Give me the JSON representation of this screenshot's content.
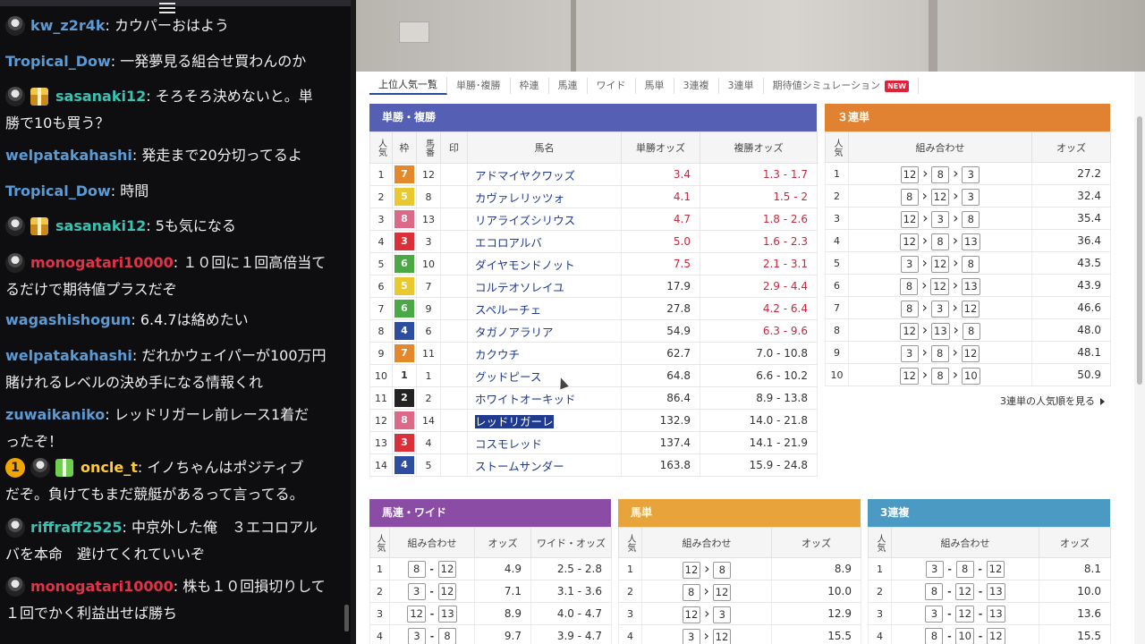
{
  "chat": {
    "messages": [
      {
        "user": "kw_z2r4k",
        "text": ": カウパーおはよう",
        "color": "#5b9bd5",
        "badges": [
          "avatar"
        ]
      },
      {
        "user": "Tropical_Dow",
        "text": ": 一発夢見る組合せ買わんのか",
        "color": "#5b9bd5",
        "badges": []
      },
      {
        "user": "sasanaki12",
        "text": ": そろそろ決めないと。単",
        "cont": "勝で10も買う？",
        "color": "#38c3b3",
        "badges": [
          "avatar",
          "gift"
        ]
      },
      {
        "user": "welpatakahashi",
        "text": ": 発走まで20分切ってるよ",
        "color": "#5b9bd5",
        "badges": []
      },
      {
        "user": "Tropical_Dow",
        "text": ": 時間",
        "color": "#5b9bd5",
        "badges": []
      },
      {
        "user": "sasanaki12",
        "text": ": 5も気になる",
        "color": "#38c3b3",
        "badges": [
          "avatar",
          "gift"
        ]
      },
      {
        "user": "monogatari10000",
        "text": ": １０回に１回高倍当て",
        "cont": "るだけで期待値プラスだぞ",
        "color": "#e0334a",
        "badges": [
          "avatar"
        ]
      },
      {
        "user": "wagashishogun",
        "text": ": 6.4.7は絡めたい",
        "color": "#5b9bd5",
        "badges": []
      },
      {
        "user": "welpatakahashi",
        "text": ": だれかウェイパーが100万円",
        "cont": "賭けれるレベルの決め手になる情報くれ",
        "color": "#5b9bd5",
        "badges": []
      },
      {
        "user": "zuwaikaniko",
        "text": ": レッドリガーレ前レース1着だ",
        "cont": "ったぞ！",
        "color": "#5b9bd5",
        "badges": []
      },
      {
        "user": "oncle_t",
        "text": ": イノちゃんはポジティブ",
        "cont": "だぞ。負けてもまだ競艇があるって言ってる。",
        "color": "#ffcc33",
        "badges": [
          "num",
          "avatar",
          "gift2"
        ],
        "num": "1"
      },
      {
        "user": "riffraff2525",
        "text": ": 中京外した俺　３エコロアル",
        "cont": "バを本命　避けてくれていいぞ",
        "color": "#38c3b3",
        "badges": [
          "avatar"
        ]
      },
      {
        "user": "monogatari10000",
        "text": ": 株も１０回損切りして",
        "cont": "１回でかく利益出せば勝ち",
        "color": "#e0334a",
        "badges": [
          "avatar"
        ]
      }
    ]
  },
  "tabs": [
    {
      "label": "上位人気一覧",
      "active": true
    },
    {
      "label": "単勝･複勝"
    },
    {
      "label": "枠連"
    },
    {
      "label": "馬連"
    },
    {
      "label": "ワイド"
    },
    {
      "label": "馬単"
    },
    {
      "label": "3連複"
    },
    {
      "label": "3連単"
    },
    {
      "label": "期待値シミュレーション",
      "new": "NEW"
    }
  ],
  "win_place": {
    "title": "単勝・複勝",
    "headers": [
      "人気",
      "枠",
      "馬番",
      "印",
      "馬名",
      "単勝オッズ",
      "複勝オッズ"
    ],
    "rows": [
      {
        "pop": "1",
        "waku": "7",
        "num": "12",
        "name": "アドマイヤクワッズ",
        "win": "3.4",
        "place": "1.3 - 1.7",
        "win_red": true,
        "place_red": true
      },
      {
        "pop": "2",
        "waku": "5",
        "num": "8",
        "name": "カヴァレリッツォ",
        "win": "4.1",
        "place": "1.5 - 2",
        "win_red": true,
        "place_red": true
      },
      {
        "pop": "3",
        "waku": "8",
        "num": "13",
        "name": "リアライズシリウス",
        "win": "4.7",
        "place": "1.8 - 2.6",
        "win_red": true,
        "place_red": true
      },
      {
        "pop": "4",
        "waku": "3",
        "num": "3",
        "name": "エコロアルバ",
        "win": "5.0",
        "place": "1.6 - 2.3",
        "win_red": true,
        "place_red": true
      },
      {
        "pop": "5",
        "waku": "6",
        "num": "10",
        "name": "ダイヤモンドノット",
        "win": "7.5",
        "place": "2.1 - 3.1",
        "win_red": true,
        "place_red": true
      },
      {
        "pop": "6",
        "waku": "5",
        "num": "7",
        "name": "コルテオソレイユ",
        "win": "17.9",
        "place": "2.9 - 4.4",
        "win_red": false,
        "place_red": true
      },
      {
        "pop": "7",
        "waku": "6",
        "num": "9",
        "name": "スペルーチェ",
        "win": "27.8",
        "place": "4.2 - 6.4",
        "win_red": false,
        "place_red": true
      },
      {
        "pop": "8",
        "waku": "4",
        "num": "6",
        "name": "タガノアラリア",
        "win": "54.9",
        "place": "6.3 - 9.6",
        "win_red": false,
        "place_red": true
      },
      {
        "pop": "9",
        "waku": "7",
        "num": "11",
        "name": "カクウチ",
        "win": "62.7",
        "place": "7.0 - 10.8",
        "win_red": false,
        "place_red": false
      },
      {
        "pop": "10",
        "waku": "1",
        "num": "1",
        "name": "グッドピース",
        "win": "64.8",
        "place": "6.6 - 10.2",
        "win_red": false,
        "place_red": false
      },
      {
        "pop": "11",
        "waku": "2",
        "num": "2",
        "name": "ホワイトオーキッド",
        "win": "86.4",
        "place": "8.9 - 13.8",
        "win_red": false,
        "place_red": false
      },
      {
        "pop": "12",
        "waku": "8",
        "num": "14",
        "name": "レッドリガーレ",
        "win": "132.9",
        "place": "14.0 - 21.8",
        "win_red": false,
        "place_red": false,
        "selected": true
      },
      {
        "pop": "13",
        "waku": "3",
        "num": "4",
        "name": "コスモレッド",
        "win": "137.4",
        "place": "14.1 - 21.9",
        "win_red": false,
        "place_red": false
      },
      {
        "pop": "14",
        "waku": "4",
        "num": "5",
        "name": "ストームサンダー",
        "win": "163.8",
        "place": "15.9 - 24.8",
        "win_red": false,
        "place_red": false
      }
    ]
  },
  "trifecta": {
    "title": "３連単",
    "headers": [
      "人気",
      "組み合わせ",
      "オッズ"
    ],
    "rows": [
      {
        "pop": "1",
        "combo": [
          "12",
          "8",
          "3"
        ],
        "odds": "27.2"
      },
      {
        "pop": "2",
        "combo": [
          "8",
          "12",
          "3"
        ],
        "odds": "32.4"
      },
      {
        "pop": "3",
        "combo": [
          "12",
          "3",
          "8"
        ],
        "odds": "35.4"
      },
      {
        "pop": "4",
        "combo": [
          "12",
          "8",
          "13"
        ],
        "odds": "36.4"
      },
      {
        "pop": "5",
        "combo": [
          "3",
          "12",
          "8"
        ],
        "odds": "43.5"
      },
      {
        "pop": "6",
        "combo": [
          "8",
          "12",
          "13"
        ],
        "odds": "43.9"
      },
      {
        "pop": "7",
        "combo": [
          "8",
          "3",
          "12"
        ],
        "odds": "46.6"
      },
      {
        "pop": "8",
        "combo": [
          "12",
          "13",
          "8"
        ],
        "odds": "48.0"
      },
      {
        "pop": "9",
        "combo": [
          "3",
          "8",
          "12"
        ],
        "odds": "48.1"
      },
      {
        "pop": "10",
        "combo": [
          "12",
          "8",
          "10"
        ],
        "odds": "50.9"
      }
    ],
    "more_link": "3連単の人気順を見る"
  },
  "quinella_wide": {
    "title": "馬連・ワイド",
    "headers": [
      "人気",
      "組み合わせ",
      "オッズ",
      "ワイド・オッズ"
    ],
    "rows": [
      {
        "pop": "1",
        "combo": [
          "8",
          "12"
        ],
        "odds": "4.9",
        "wide": "2.5 - 2.8"
      },
      {
        "pop": "2",
        "combo": [
          "3",
          "12"
        ],
        "odds": "7.1",
        "wide": "3.1 - 3.6"
      },
      {
        "pop": "3",
        "combo": [
          "12",
          "13"
        ],
        "odds": "8.9",
        "wide": "4.0 - 4.7"
      },
      {
        "pop": "4",
        "combo": [
          "3",
          "8"
        ],
        "odds": "9.7",
        "wide": "3.9 - 4.7"
      }
    ]
  },
  "exacta": {
    "title": "馬単",
    "headers": [
      "人気",
      "組み合わせ",
      "オッズ"
    ],
    "rows": [
      {
        "pop": "1",
        "combo": [
          "12",
          "8"
        ],
        "odds": "8.9"
      },
      {
        "pop": "2",
        "combo": [
          "8",
          "12"
        ],
        "odds": "10.0"
      },
      {
        "pop": "3",
        "combo": [
          "12",
          "3"
        ],
        "odds": "12.9"
      },
      {
        "pop": "4",
        "combo": [
          "3",
          "12"
        ],
        "odds": "15.5"
      }
    ]
  },
  "trio": {
    "title": "3連複",
    "headers": [
      "人気",
      "組み合わせ",
      "オッズ"
    ],
    "rows": [
      {
        "pop": "1",
        "combo": [
          "3",
          "8",
          "12"
        ],
        "odds": "8.1"
      },
      {
        "pop": "2",
        "combo": [
          "8",
          "12",
          "13"
        ],
        "odds": "10.0"
      },
      {
        "pop": "3",
        "combo": [
          "3",
          "12",
          "13"
        ],
        "odds": "13.6"
      },
      {
        "pop": "4",
        "combo": [
          "8",
          "10",
          "12"
        ],
        "odds": "15.5"
      }
    ]
  },
  "colors": {
    "win_place_header": "#5560b5",
    "trifecta_header": "#e08232",
    "quinella_header": "#8a4ca4",
    "exacta_header": "#e8a43a",
    "trio_header": "#4b9ac4",
    "odds_red": "#c8283c",
    "link_blue": "#1f3a8e"
  }
}
